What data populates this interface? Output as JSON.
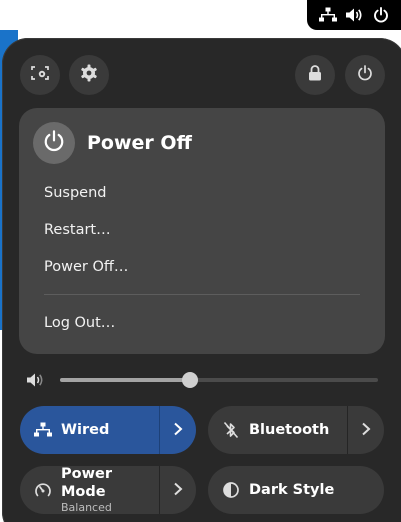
{
  "tray": {
    "icons": [
      "network-wired-icon",
      "volume-icon",
      "power-icon"
    ]
  },
  "toolbar": {
    "left_buttons": [
      "screenshot-icon",
      "settings-gear-icon"
    ],
    "right_buttons": [
      "lock-icon",
      "power-icon"
    ]
  },
  "power_menu": {
    "title": "Power Off",
    "items": [
      "Suspend",
      "Restart…",
      "Power Off…"
    ],
    "logout": "Log Out…"
  },
  "volume": {
    "level": 0.41
  },
  "toggles": {
    "wired": {
      "label": "Wired",
      "active": true
    },
    "bluetooth": {
      "label": "Bluetooth",
      "active": false
    },
    "power_mode": {
      "label": "Power Mode",
      "sublabel": "Balanced",
      "active": false
    },
    "dark_style": {
      "label": "Dark Style",
      "active": false
    }
  },
  "colors": {
    "panel_bg": "#282828",
    "submenu_bg": "#454545",
    "active_toggle": "#2a569c",
    "inactive_toggle": "#3a3a3a",
    "desktop_blue": "#1a73c9"
  }
}
